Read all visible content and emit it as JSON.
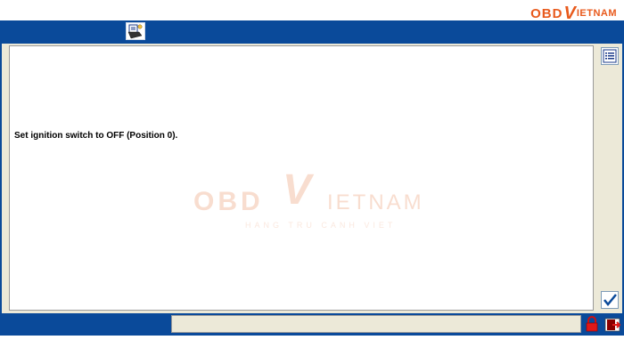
{
  "logo": {
    "left": "OBD",
    "mark": "V",
    "right": "IETNAM",
    "tagline": "HANG TRU CANH VIET",
    "brand_color": "#e85a1c"
  },
  "window": {
    "title_icon": "printer-icon",
    "frame_color": "#0a4a9a"
  },
  "main": {
    "message": "Set ignition switch to OFF (Position 0)."
  },
  "sidebar": {
    "list_icon": "list-icon",
    "confirm_icon": "checkmark-icon"
  },
  "status": {
    "text": "",
    "icons": [
      "lock-icon",
      "exit-icon"
    ]
  }
}
